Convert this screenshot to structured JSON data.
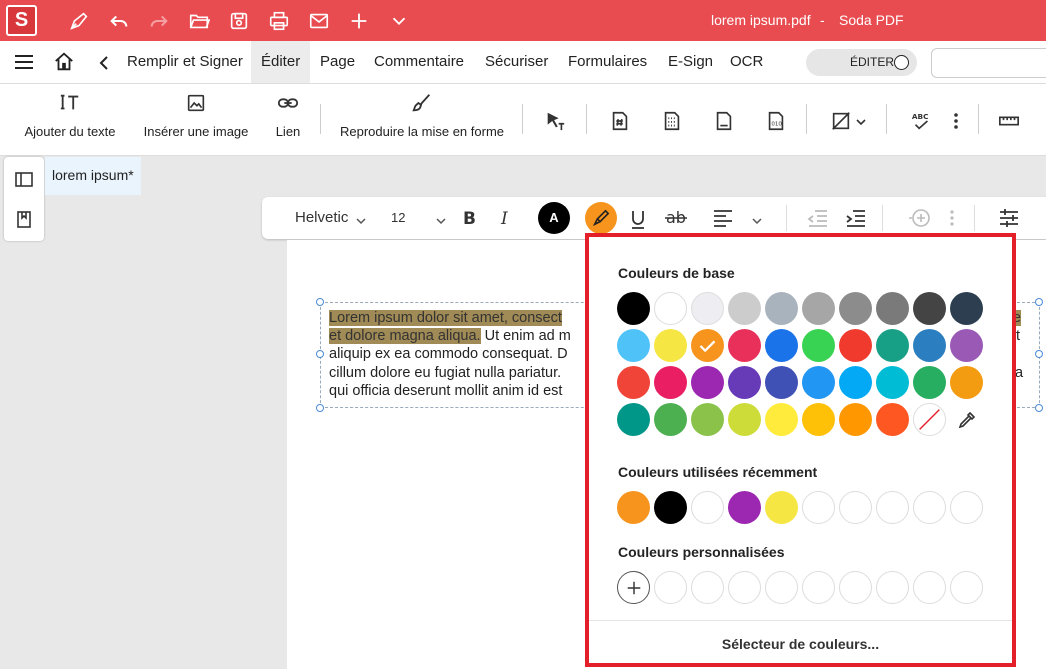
{
  "titlebar": {
    "logo": "S",
    "document_title": "lorem ipsum.pdf",
    "separator": "-",
    "app_name": "Soda PDF"
  },
  "menu": {
    "items": [
      "Remplir et Signer",
      "Éditer",
      "Page",
      "Commentaire",
      "Sécuriser",
      "Formulaires",
      "E-Sign",
      "OCR"
    ],
    "active": "Éditer",
    "edit_toggle": "ÉDITER"
  },
  "toolbar": {
    "add_text": "Ajouter du texte",
    "insert_image": "Insérer une image",
    "link": "Lien",
    "format_painter": "Reproduire la mise en forme"
  },
  "tab": {
    "label": "lorem ipsum",
    "modified": "*"
  },
  "format": {
    "font": "Helvetic",
    "size": "12",
    "text_color_letter": "A"
  },
  "document": {
    "line1a": "Lorem ipsum dolor sit amet, consect",
    "line1b": "re",
    "line2a": "et dolore magna aliqua.",
    "line2b": " Ut enim ad m",
    "line2c": "t",
    "line3": "aliquip ex ea commodo consequat. D",
    "line4": "cillum dolore eu fugiat nulla pariatur.",
    "line4b": "a",
    "line5": "qui officia deserunt mollit anim id est"
  },
  "color_picker": {
    "basic_title": "Couleurs de base",
    "recent_title": "Couleurs utilisées récemment",
    "custom_title": "Couleurs personnalisées",
    "picker_button": "Sélecteur de couleurs...",
    "selected": "#f7941d",
    "basic_colors": [
      [
        "#000000",
        "#ffffff",
        "#eeeef2",
        "#cccccc",
        "#a9b3bd",
        "#a6a6a6",
        "#8c8c8c",
        "#7a7a7a",
        "#444444",
        "#2d3e50"
      ],
      [
        "#4fc3f7",
        "#f6e643",
        "#f7941d",
        "#e8305a",
        "#1a73e8",
        "#39d353",
        "#f03a2e",
        "#17a085",
        "#2b7fc0",
        "#9b59b6"
      ],
      [
        "#f04438",
        "#e91e63",
        "#9c27b0",
        "#673ab7",
        "#3f51b5",
        "#2196f3",
        "#03a9f4",
        "#00bcd4",
        "#27ae60",
        "#f39c12"
      ],
      [
        "#009688",
        "#4caf50",
        "#8bc34a",
        "#cddc39",
        "#ffeb3b",
        "#ffc107",
        "#ff9800",
        "#ff5722",
        "none",
        "eyedropper"
      ]
    ],
    "recent_colors": [
      "#f7941d",
      "#000000",
      "#ffffff",
      "#9c27b0",
      "#f6e643",
      "#ffffff",
      "#ffffff",
      "#ffffff",
      "#ffffff",
      "#ffffff"
    ],
    "custom_colors": [
      "add",
      "#ffffff",
      "#ffffff",
      "#ffffff",
      "#ffffff",
      "#ffffff",
      "#ffffff",
      "#ffffff",
      "#ffffff",
      "#ffffff"
    ]
  }
}
